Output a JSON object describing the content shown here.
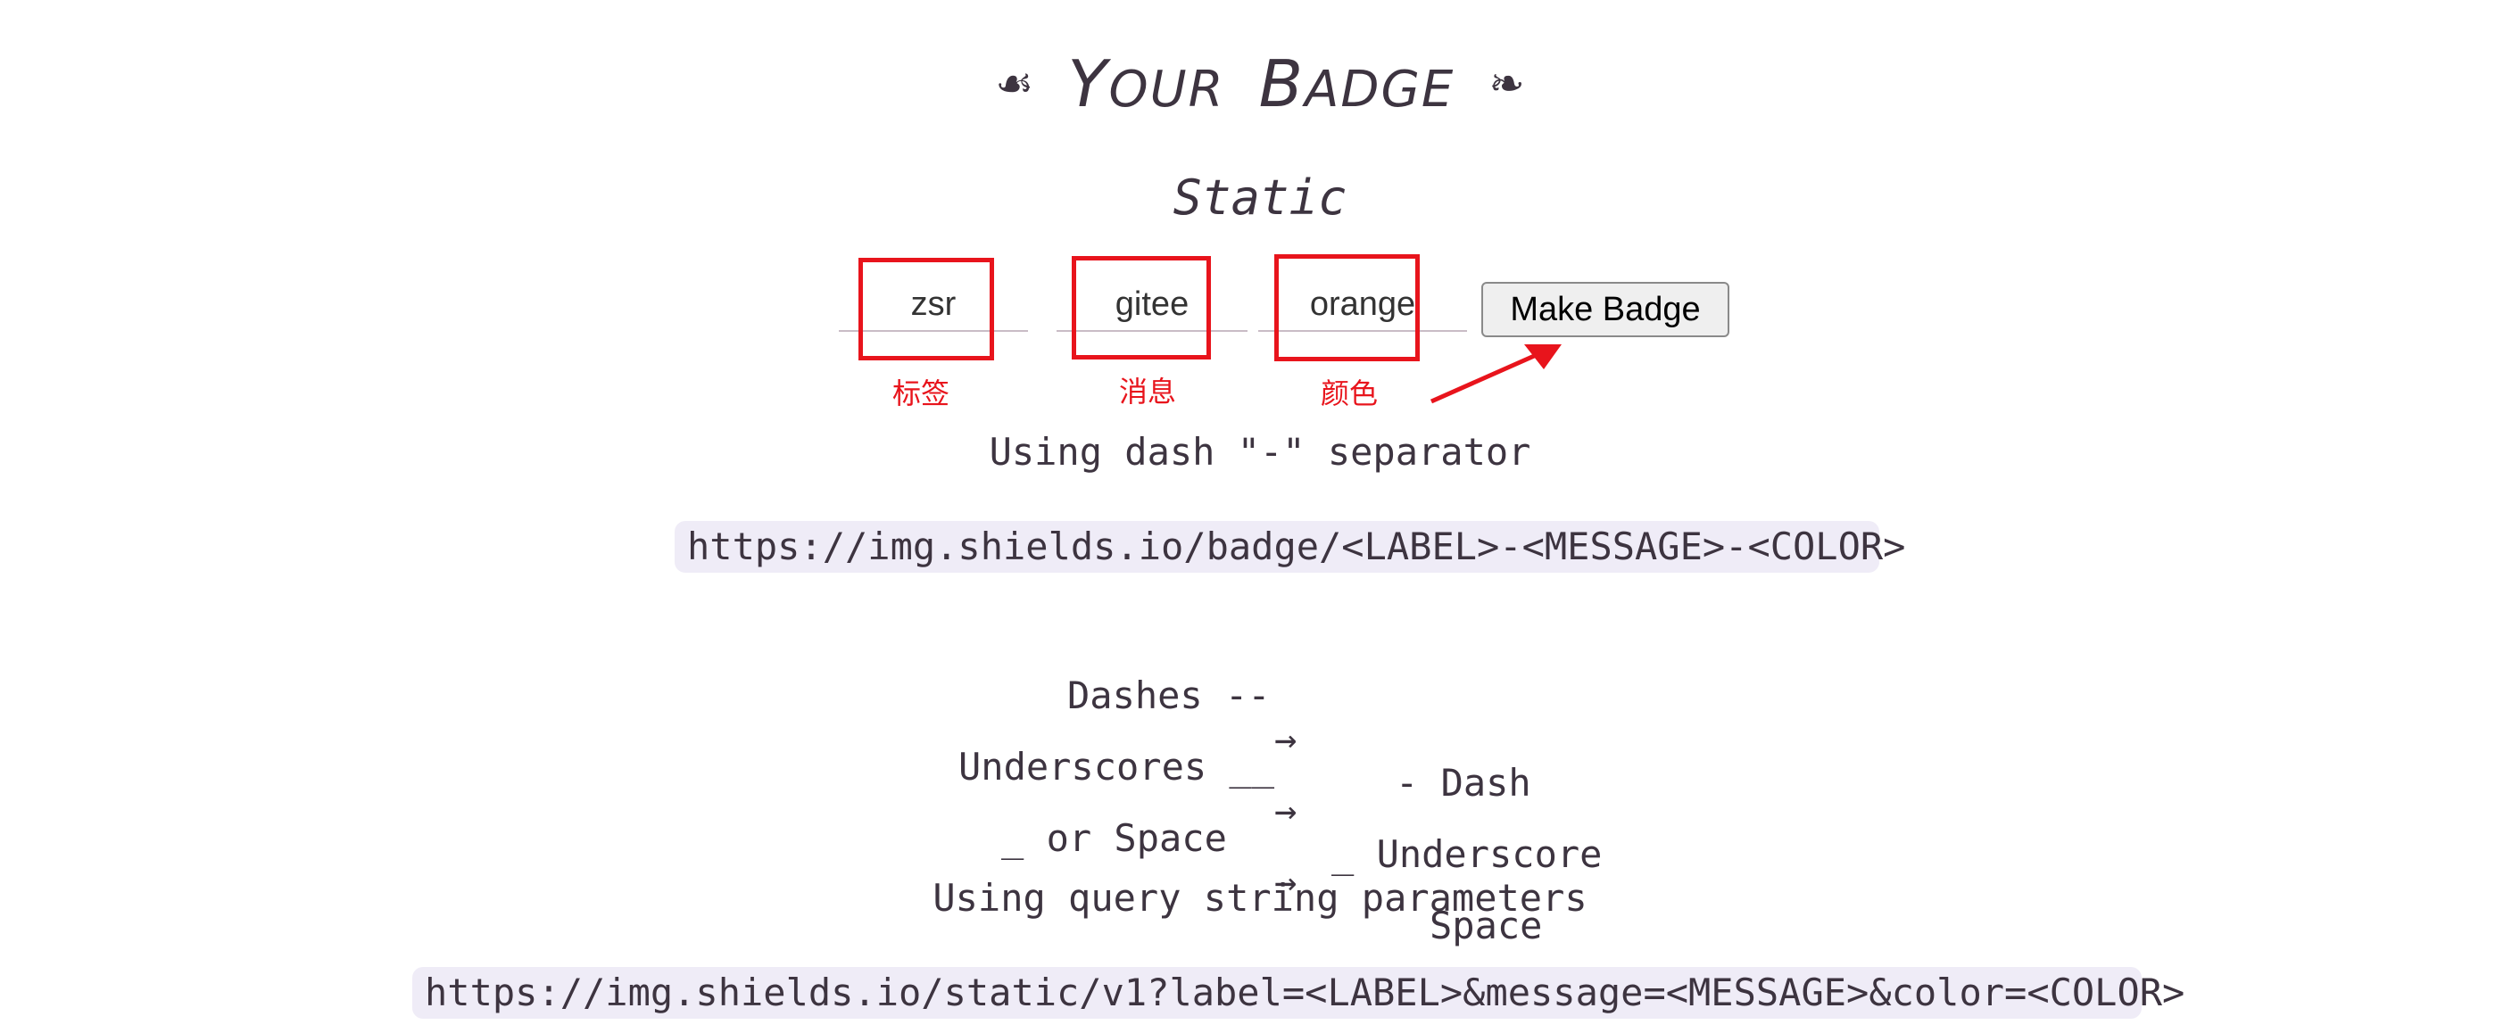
{
  "header": {
    "title_word1_initial": "Y",
    "title_word1_rest": "OUR",
    "title_word2_initial": "B",
    "title_word2_rest": "ADGE",
    "ornament_left": "☙",
    "ornament_right": "❧"
  },
  "section": {
    "title": "Static"
  },
  "form": {
    "label_value": "zsr",
    "message_value": "gitee",
    "color_value": "orange",
    "make_button": "Make Badge"
  },
  "annotations": {
    "label_note": "标签",
    "message_note": "消息",
    "color_note": "颜色",
    "highlight_color": "#e8141c"
  },
  "dash_section": {
    "heading": "Using dash \"-\" separator",
    "url_pattern": "https://img.shields.io/badge/<LABEL>-<MESSAGE>-<COLOR>"
  },
  "escape_rules": [
    {
      "input": "Dashes --",
      "arrow": "→",
      "output": "- Dash"
    },
    {
      "input": "Underscores __",
      "arrow": "→",
      "output": "_ Underscore"
    },
    {
      "input": "_ or Space",
      "arrow": "→",
      "output": "Space"
    }
  ],
  "query_section": {
    "heading": "Using query string parameters",
    "url_pattern": "https://img.shields.io/static/v1?label=<LABEL>&message=<MESSAGE>&color=<COLOR>"
  },
  "colors": {
    "text": "#3d3440",
    "code_bg": "#efecf7",
    "annotation": "#e8141c"
  }
}
